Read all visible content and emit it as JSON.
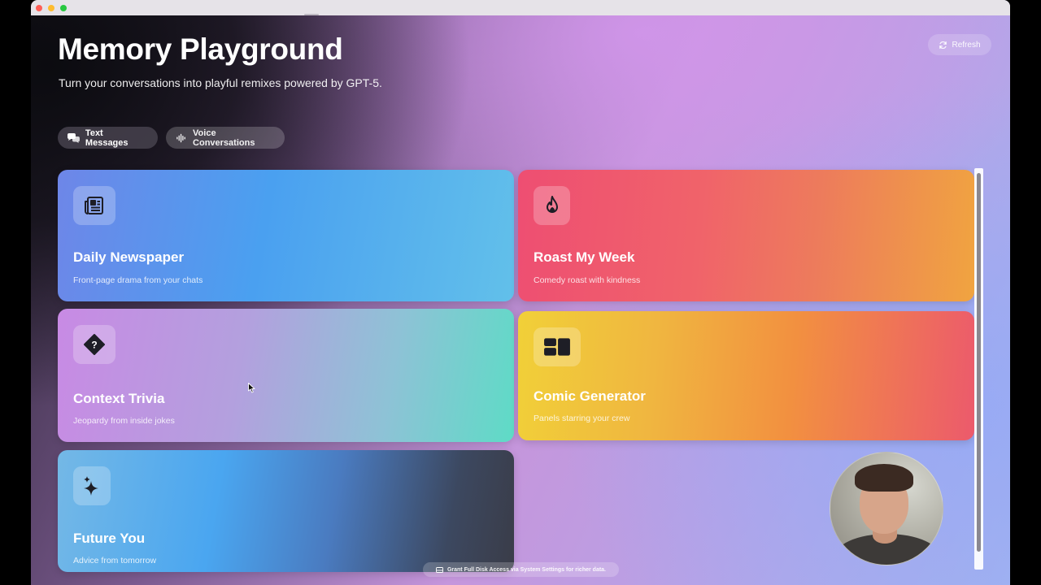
{
  "app": {
    "title": "Memory Playground",
    "subtitle": "Turn your conversations into playful remixes powered by GPT-5.",
    "refresh_label": "Refresh"
  },
  "tabs": [
    {
      "label": "Text Messages",
      "icon": "chat-bubbles-icon",
      "selected": true
    },
    {
      "label": "Voice Conversations",
      "icon": "waveform-icon",
      "selected": false
    }
  ],
  "cards": [
    {
      "title": "Daily Newspaper",
      "description": "Front-page drama from your chats",
      "icon": "newspaper-icon"
    },
    {
      "title": "Roast My Week",
      "description": "Comedy roast with kindness",
      "icon": "flame-icon"
    },
    {
      "title": "Context Trivia",
      "description": "Jeopardy from inside jokes",
      "icon": "question-diamond-icon"
    },
    {
      "title": "Comic Generator",
      "description": "Panels starring your crew",
      "icon": "comic-panels-icon"
    },
    {
      "title": "Future You",
      "description": "Advice from tomorrow",
      "icon": "sparkles-icon"
    }
  ],
  "toast": {
    "text": "Grant Full Disk Access via System Settings for richer data.",
    "icon": "drive-icon"
  },
  "colors": {
    "accent_red": "#ee4e72",
    "accent_blue": "#4aa0f0",
    "accent_yellow": "#f1d038",
    "accent_teal": "#5edbc6"
  }
}
